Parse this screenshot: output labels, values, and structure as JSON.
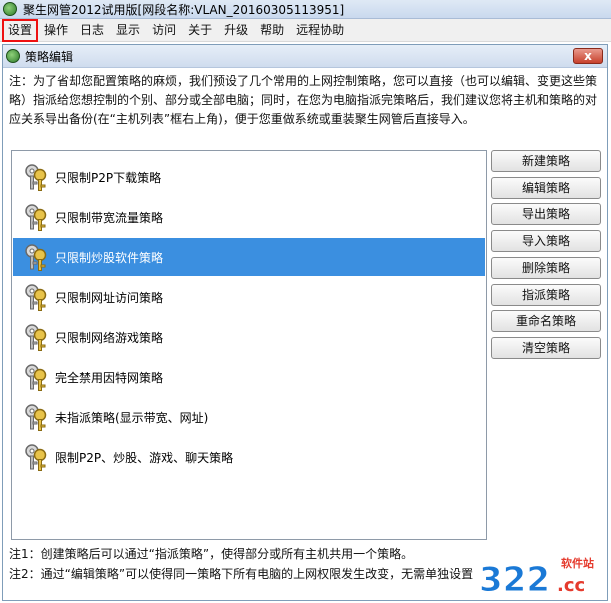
{
  "app": {
    "title": "聚生网管2012试用版[网段名称:VLAN_20160305113951]"
  },
  "menu": [
    "设置",
    "操作",
    "日志",
    "显示",
    "访问",
    "关于",
    "升级",
    "帮助",
    "远程协助"
  ],
  "dialog": {
    "title": "策略编辑",
    "close_label": "x",
    "note_top": "注：为了省却您配置策略的麻烦，我们预设了几个常用的上网控制策略，您可以直接（也可以编辑、变更这些策略）指派给您想控制的个别、部分或全部电脑；同时，在您为电脑指派完策略后，我们建议您将主机和策略的对应关系导出备份(在“主机列表”框右上角)，便于您重做系统或重装聚生网管后直接导入。"
  },
  "strategies": [
    {
      "label": "只限制P2P下载策略"
    },
    {
      "label": "只限制带宽流量策略"
    },
    {
      "label": "只限制炒股软件策略"
    },
    {
      "label": "只限制网址访问策略"
    },
    {
      "label": "只限制网络游戏策略"
    },
    {
      "label": "完全禁用因特网策略"
    },
    {
      "label": "未指派策略(显示带宽、网址)"
    },
    {
      "label": "限制P2P、炒股、游戏、聊天策略"
    }
  ],
  "selected_index": 2,
  "buttons": {
    "new": "新建策略",
    "edit": "编辑策略",
    "export": "导出策略",
    "import": "导入策略",
    "delete": "删除策略",
    "assign": "指派策略",
    "rename": "重命名策略",
    "clear": "清空策略"
  },
  "notes_bottom": {
    "note1": "注1：创建策略后可以通过“指派策略”，使得部分或所有主机共用一个策略。",
    "note2": "注2：通过“编辑策略”可以使得同一策略下所有电脑的上网权限发生改变，无需单独设置"
  },
  "watermark": {
    "brand": "322",
    "suffix": ".cc",
    "tag": "软件站"
  },
  "colors": {
    "selection": "#3b8fe0",
    "highlight_box": "#ee1111",
    "watermark_blue": "#1a79d6",
    "watermark_red": "#e53b2e"
  }
}
